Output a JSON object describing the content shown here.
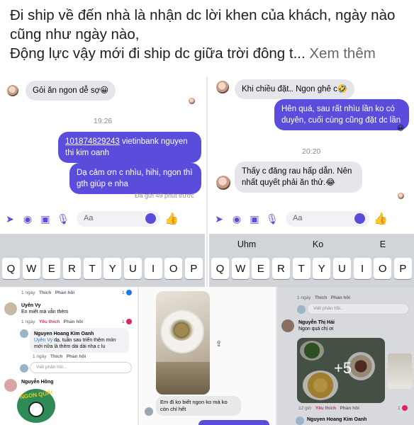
{
  "caption": {
    "line1": "Đi ship về đến nhà là nhận dc lời khen của khách, ngày nào cũng như ngày nào,",
    "line2": "Động lực vậy mới đi ship dc giữa trời đông t...",
    "more": "Xem thêm"
  },
  "left_chat": {
    "msg_top": "Gỏi ăn ngon dễ sợ😀",
    "time": "19:26",
    "msg_account_number": "101874829243",
    "msg_account_rest": " vietinbank nguyen thi kim oanh",
    "msg_thanks": "Dạ cảm ơn c nhìu, hihi, ngon thì gth giúp e nha",
    "seen": "Đã gửi 49 phút trước",
    "composer_placeholder": "Aa"
  },
  "right_chat": {
    "msg_top": "Khi chiều đặt.. Ngon ghê c🤣",
    "msg_out": "Hên quá, sau rất nhìu lần ko có duyên, cuối cùng cũng đặt dc lần",
    "time": "20:20",
    "msg_in": "Thấy c đăng rau hấp dẫn. Nên nhất quyết phải ăn thử.😂",
    "composer_placeholder": "Aa"
  },
  "keyboard": {
    "suggestions": [
      "Uhm",
      "Ko",
      "E"
    ],
    "keys_left": [
      "Q",
      "W",
      "E",
      "R",
      "T",
      "Y",
      "U",
      "I",
      "O",
      "P"
    ],
    "keys_right": [
      "Q",
      "W",
      "E",
      "R",
      "T",
      "Y",
      "U",
      "I",
      "O",
      "P"
    ]
  },
  "comments_1": {
    "meta_top": {
      "time": "1 ngày",
      "like": "Thích",
      "reply": "Phản hồi",
      "count": "1"
    },
    "c1_name": "Uyên Vy",
    "c1_text": "En miết mà vẫn thèm",
    "c1_meta": {
      "time": "1 ngày",
      "like": "Yêu thích",
      "reply": "Phản hồi",
      "count": "1"
    },
    "c2_name": "Nguyen Hoang Kim Oanh",
    "c2_tag": "Uyên Vy",
    "c2_text": " dạ, tuần sau triển thêm món mới nữa là thèm dài dài nha c lu",
    "c2_meta": {
      "time": "1 ngày",
      "like": "Thích",
      "reply": "Phản hồi"
    },
    "reply_placeholder": "Viết phản hồi...",
    "c3_name": "Nguyễn Hồng",
    "sticker_text": "NGON QUÁ!"
  },
  "comments_2": {
    "msg": "Em đi ko biết ngon ko mà ko còn chỉ hết"
  },
  "comments_3": {
    "meta_top": {
      "time": "1 ngày",
      "like": "Thích",
      "reply": "Phản hồi"
    },
    "reply_placeholder": "Viết phản hồi...",
    "c1_name": "Nguyễn Thị Hải",
    "c1_text": "Ngon quá chị ơi",
    "photos_more": "+5",
    "c1_meta": {
      "time": "12 giờ",
      "like": "Yêu thích",
      "reply": "Phản hồi",
      "count": "1"
    },
    "c2_name": "Nguyen Hoang Kim Oanh"
  },
  "colors": {
    "messenger_blue": "#5b4ddb",
    "bubble_grey": "#e4e6eb",
    "keyboard_bg": "#d1d4d9"
  }
}
